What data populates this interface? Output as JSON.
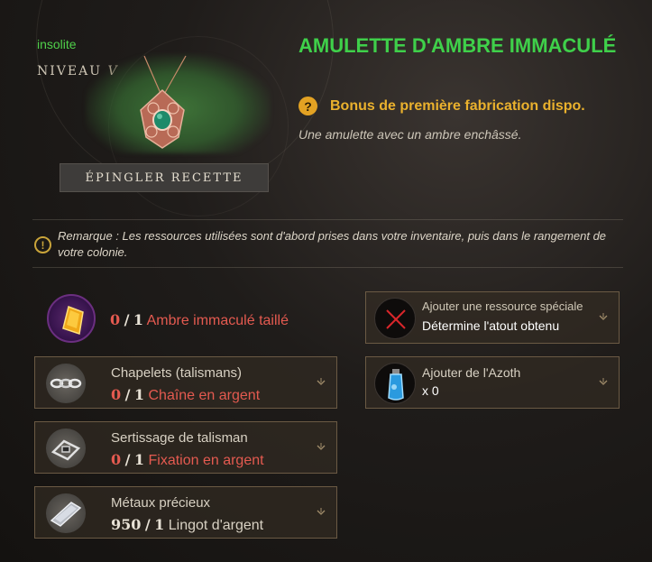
{
  "item": {
    "rarity": "insolite",
    "tier_label": "NIVEAU",
    "tier_roman": "V",
    "title": "AMULETTE D'AMBRE IMMACULÉ",
    "bonus": "Bonus de première fabrication dispo.",
    "description": "Une amulette avec un ambre enchâssé."
  },
  "pin_button": "ÉPINGLER RECETTE",
  "note": {
    "text": "Remarque : Les ressources utilisées sont d'abord prises dans votre inventaire, puis dans le rangement de votre colonie."
  },
  "ingredients": [
    {
      "category": "",
      "have": "0",
      "sep": "/",
      "need": "1",
      "name": "Ambre immaculé taillé",
      "icon": "amber-gem-icon"
    },
    {
      "category": "Chapelets (talismans)",
      "have": "0",
      "sep": "/",
      "need": "1",
      "name": "Chaîne en argent",
      "icon": "silver-chain-icon"
    },
    {
      "category": "Sertissage de talisman",
      "have": "0",
      "sep": "/",
      "need": "1",
      "name": "Fixation en argent",
      "icon": "silver-setting-icon"
    },
    {
      "category": "Métaux précieux",
      "have": "950",
      "sep": "/",
      "need": "1",
      "name": "Lingot d'argent",
      "icon": "silver-ingot-icon"
    }
  ],
  "special": {
    "title": "Ajouter une ressource spéciale",
    "subtitle": "Détermine l'atout obtenu",
    "icon": "empty-slot-x-icon"
  },
  "azoth": {
    "title": "Ajouter de l'Azoth",
    "amount": "x 0",
    "icon": "azoth-flask-icon"
  },
  "colors": {
    "rarity": "#4fd04a",
    "title": "#3fd04a",
    "bonus": "#eab12d",
    "missing": "#e45a50"
  }
}
